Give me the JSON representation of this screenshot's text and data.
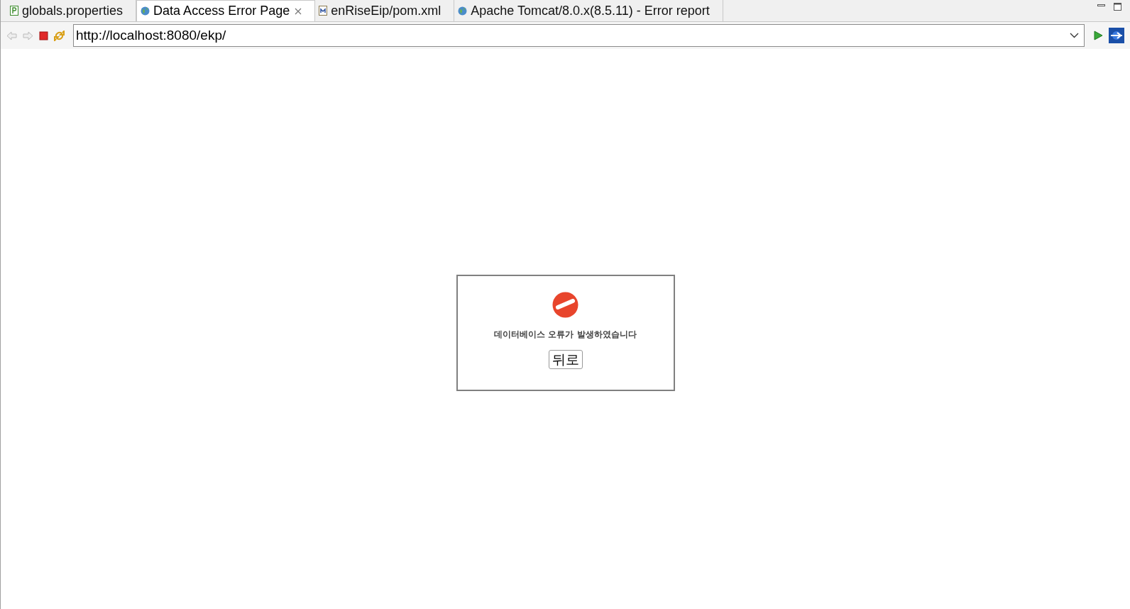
{
  "tabs": [
    {
      "label": "globals.properties",
      "kind": "properties",
      "selected": false,
      "closable": false
    },
    {
      "label": "Data Access Error Page",
      "kind": "web",
      "selected": true,
      "closable": true
    },
    {
      "label": "enRiseEip/pom.xml",
      "kind": "maven",
      "selected": false,
      "closable": false
    },
    {
      "label": "Apache Tomcat/8.0.x(8.5.11) - Error report",
      "kind": "web",
      "selected": false,
      "closable": false
    }
  ],
  "toolbar": {
    "back_disabled": true,
    "forward_disabled": true,
    "url": "http://localhost:8080/ekp/"
  },
  "error_box": {
    "message": "데이터베이스 오류가 발생하였습니다",
    "button": "뒤로"
  }
}
